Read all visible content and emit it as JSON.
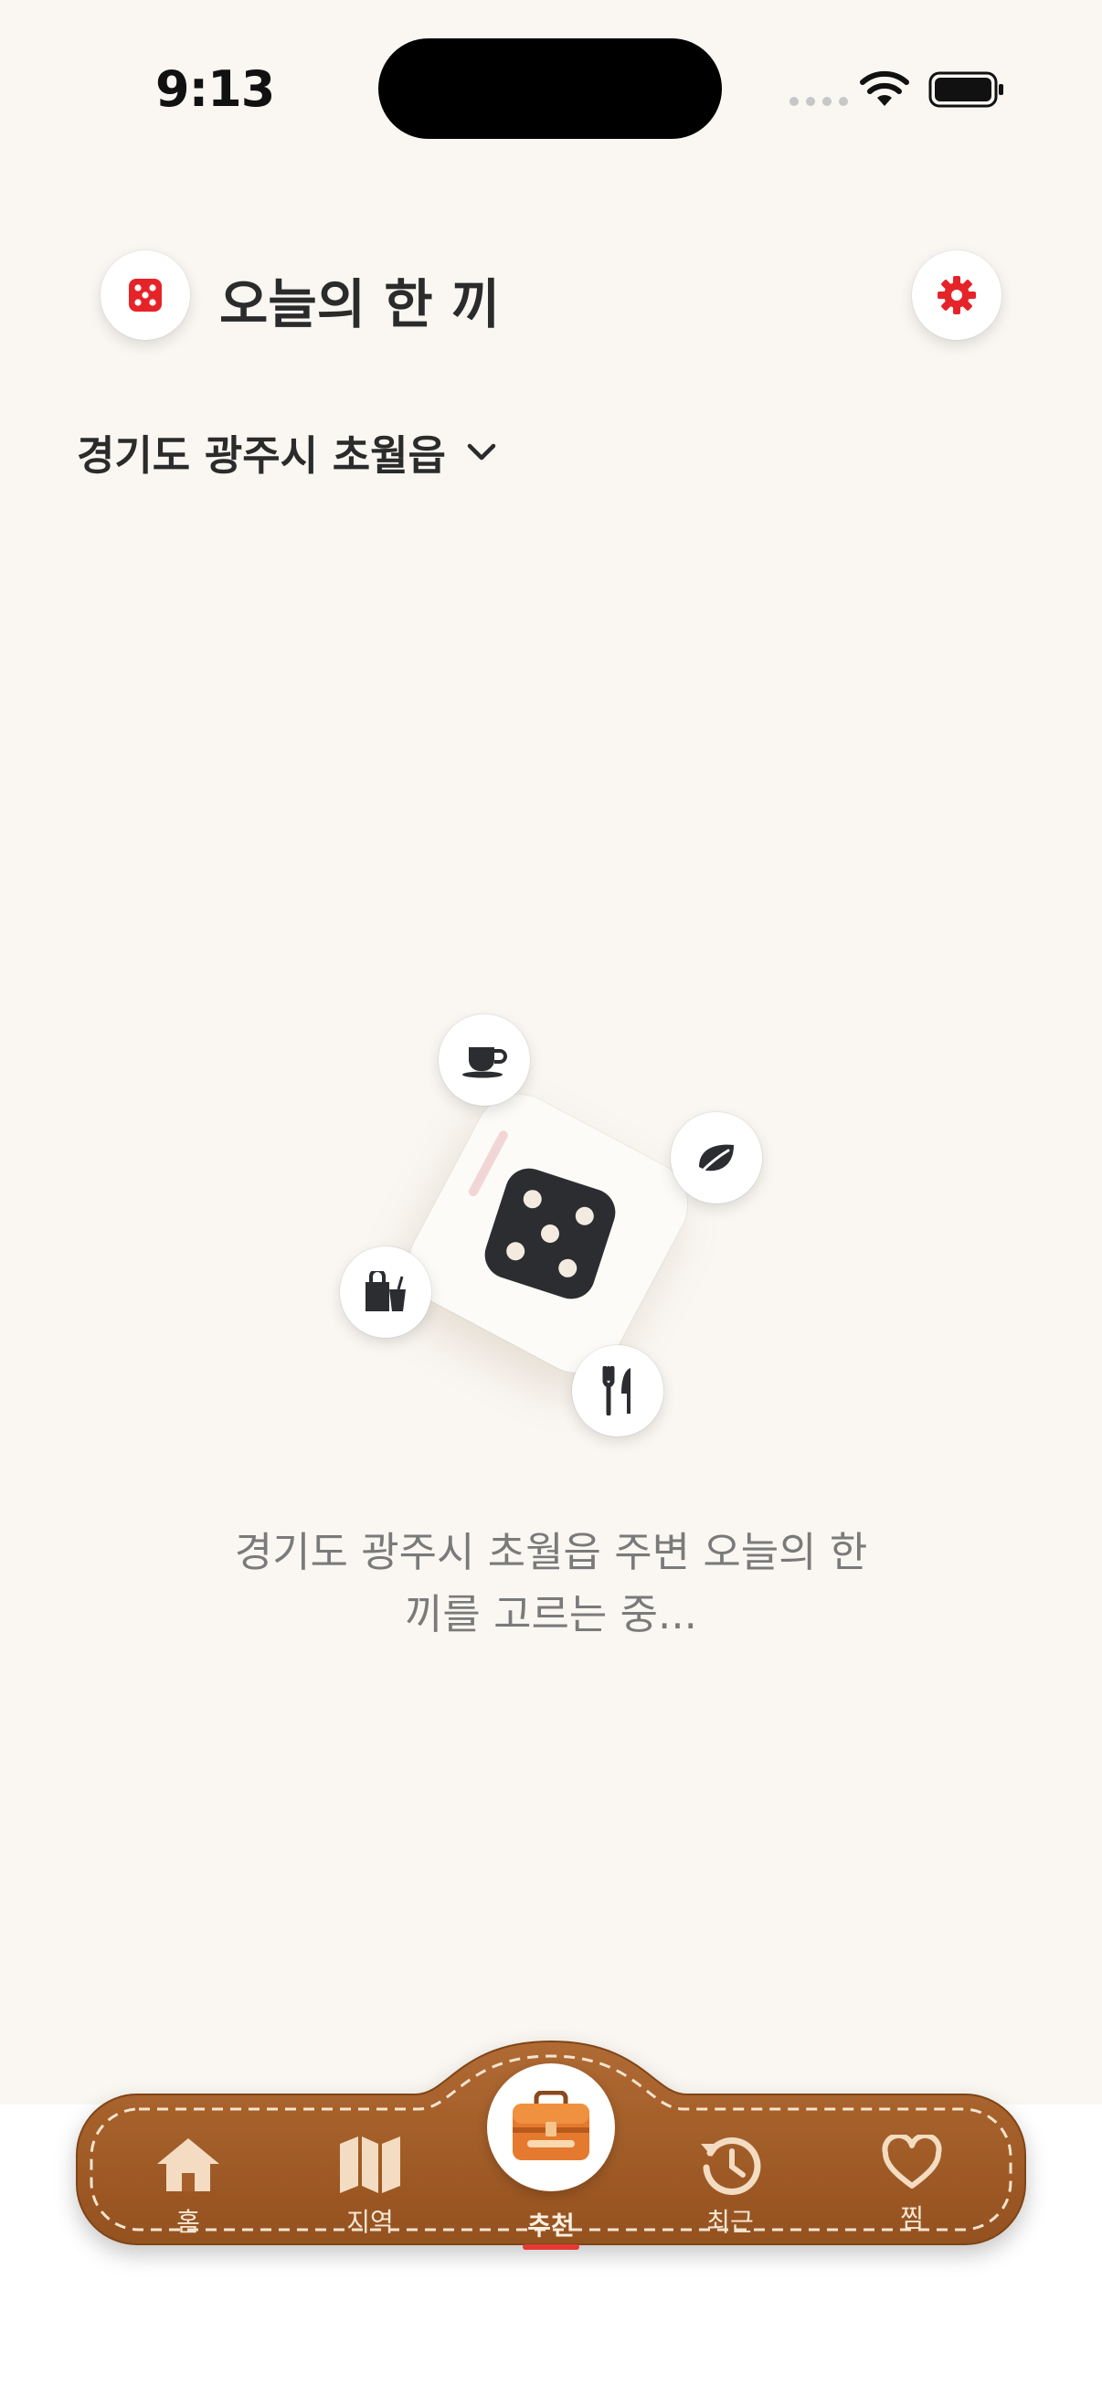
{
  "status_bar": {
    "time": "9:13"
  },
  "header": {
    "title": "오늘의 한 끼",
    "logo_icon": "dice-icon",
    "settings_icon": "gear-icon",
    "accent_color": "#E5242A"
  },
  "location": {
    "label": "경기도 광주시 초월읍",
    "chevron_icon": "chevron-down-icon"
  },
  "loading": {
    "message_line1": "경기도 광주시 초월읍 주변 오늘의 한",
    "message_line2": "끼를 고르는 중..."
  },
  "orbit_icons": [
    "coffee-cup-icon",
    "leaf-icon",
    "takeout-bag-icon",
    "utensils-icon"
  ],
  "tab_bar": {
    "color": "#A65E2A",
    "items": [
      {
        "label": "홈",
        "icon": "home-icon"
      },
      {
        "label": "지역",
        "icon": "map-icon"
      },
      {
        "label": "추천",
        "icon": "toolbox-icon",
        "active": true
      },
      {
        "label": "최근",
        "icon": "history-icon"
      },
      {
        "label": "찜",
        "icon": "heart-icon"
      }
    ]
  }
}
